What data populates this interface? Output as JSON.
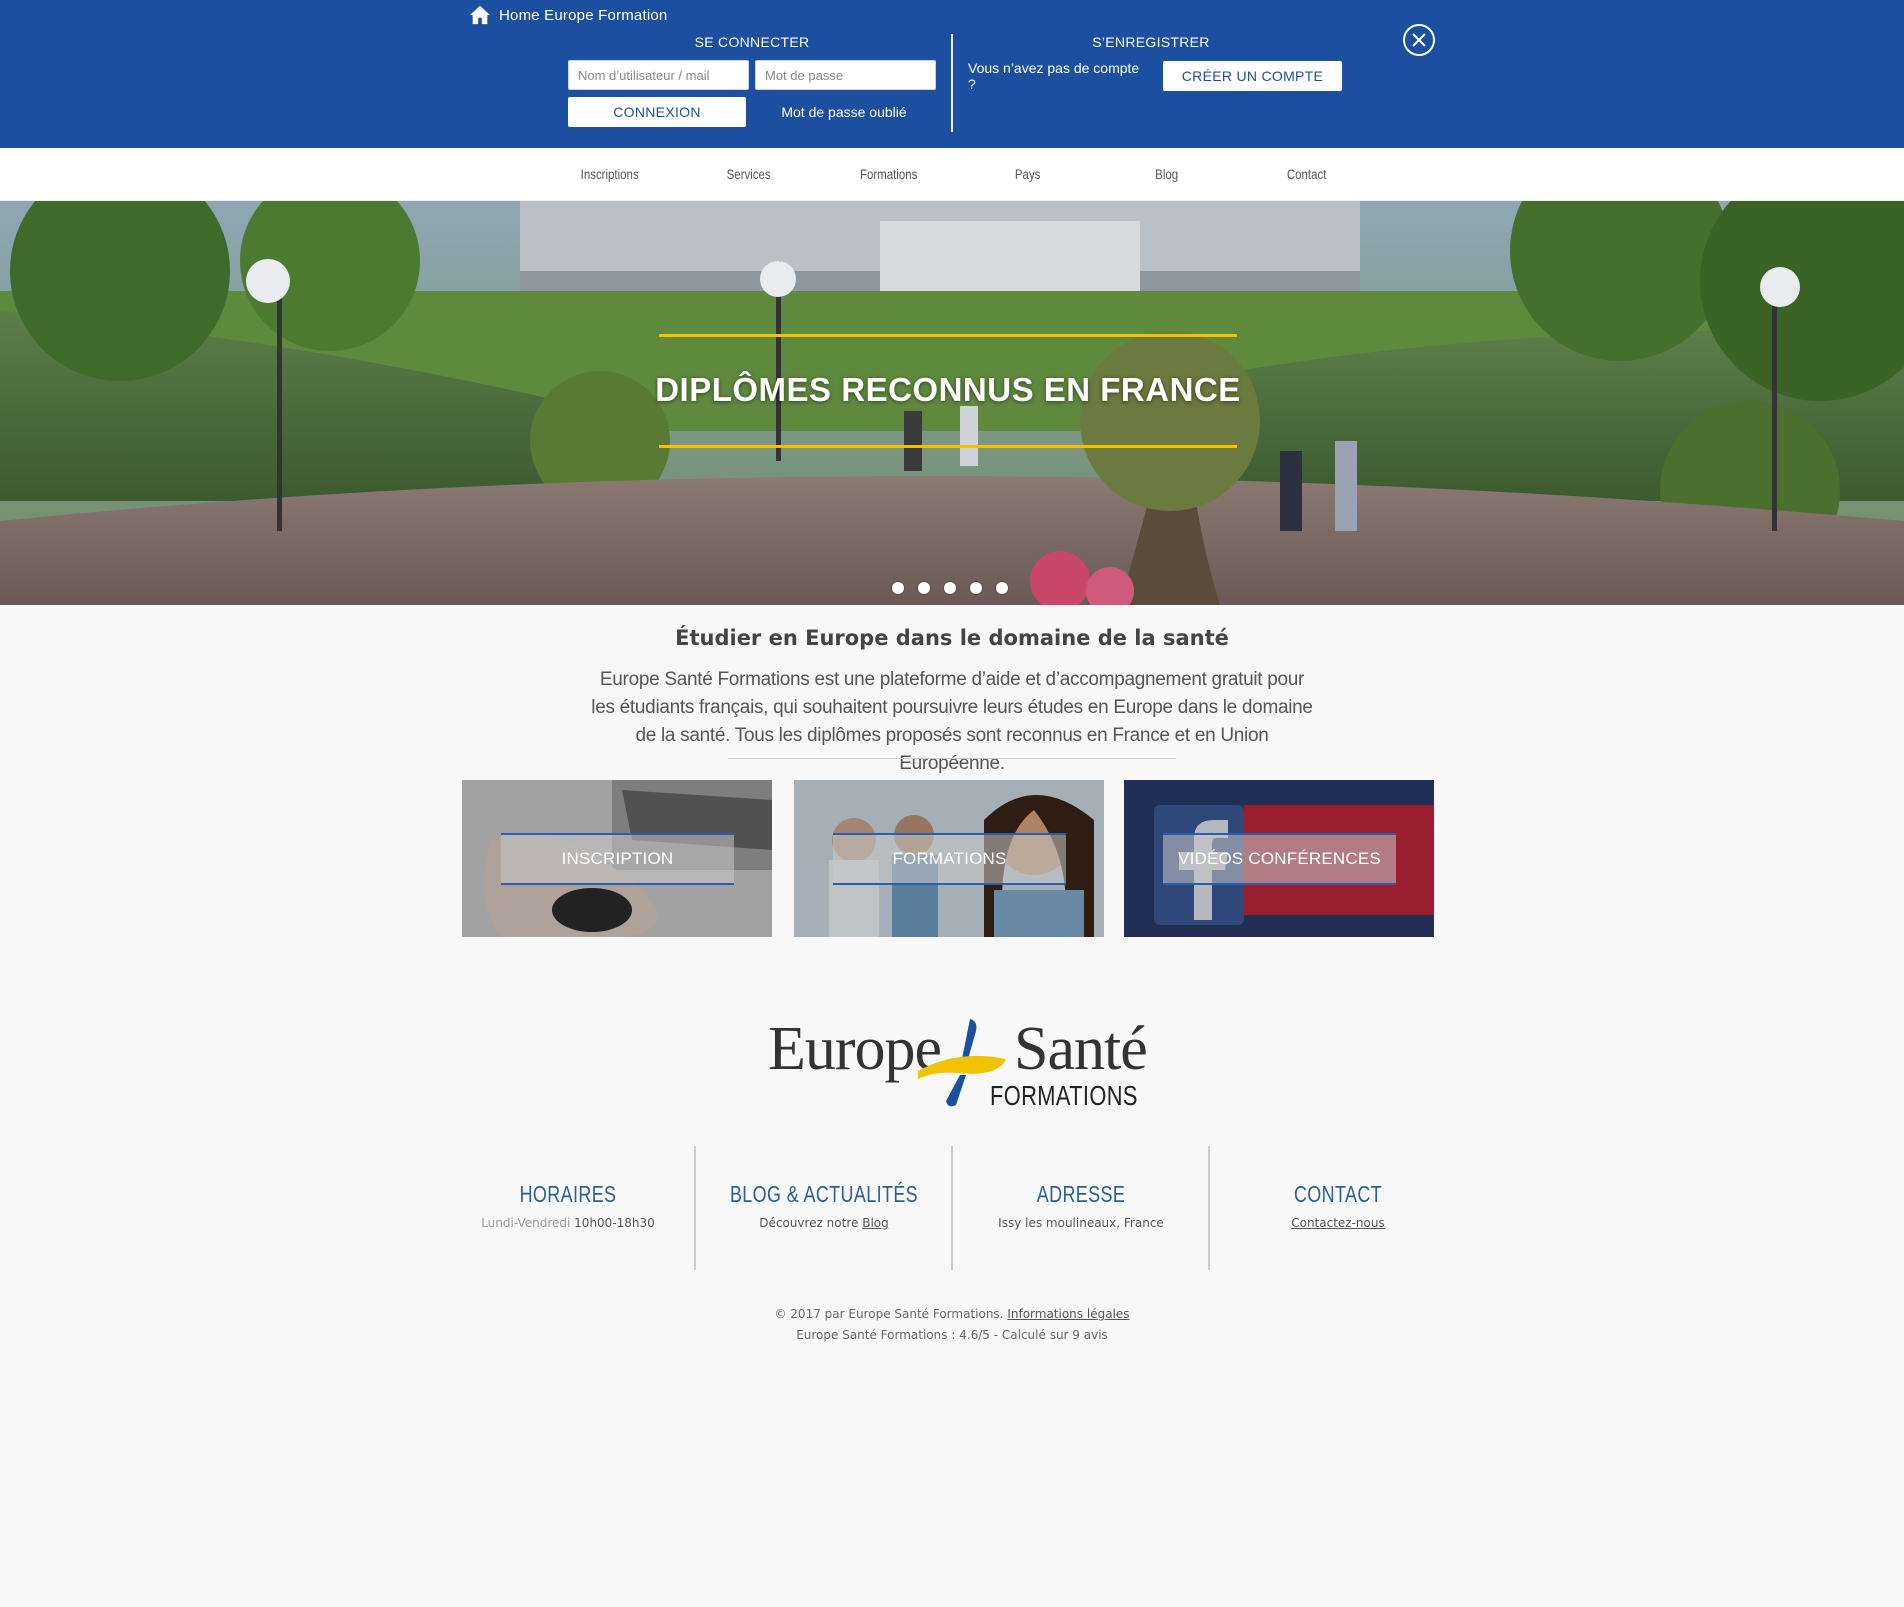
{
  "topbar": {
    "home_label": "Home Europe Formation",
    "login_title": "SE CONNECTER",
    "username_placeholder": "Nom d’utilisateur / mail",
    "password_placeholder": "Mot de passe",
    "login_button": "CONNEXION",
    "forgot_password": "Mot de passe oublié",
    "register_title": "S’ENREGISTRER",
    "no_account_question": "Vous n’avez pas de compte ?",
    "create_account_button": "CRÉER UN COMPTE"
  },
  "nav": {
    "items": [
      "Inscriptions",
      "Services",
      "Formations",
      "Pays",
      "Blog",
      "Contact"
    ]
  },
  "hero": {
    "title": "DIPLÔMES RECONNUS EN FRANCE",
    "slide_count": 5,
    "accent_color": "#f2c200"
  },
  "intro": {
    "title": "Étudier en Europe dans le domaine de la santé",
    "text": "Europe Santé Formations est une plateforme d’aide et d’accompagnement gratuit pour les étudiants français, qui souhaitent poursuivre leurs études en Europe dans le domaine de la santé. Tous les diplômes proposés sont reconnus en France et en Union Européenne."
  },
  "tiles": [
    {
      "label": "INSCRIPTION"
    },
    {
      "label": "FORMATIONS"
    },
    {
      "label": "VIDÉOS CONFÉRENCES"
    }
  ],
  "logo": {
    "word1": "Europe",
    "word2": "Santé",
    "word3": "FORMATIONS"
  },
  "footer": {
    "hours": {
      "title": "HORAIRES",
      "days": "Lundi-Vendredi",
      "time": "10h00-18h30"
    },
    "blog": {
      "title": "BLOG & ACTUALITÉS",
      "text": "Découvrez notre",
      "link": "Blog"
    },
    "address": {
      "title": "ADRESSE",
      "text": "Issy les moulineaux, France"
    },
    "contact": {
      "title": "CONTACT",
      "link": "Contactez-nous"
    },
    "copyright": "© 2017 par Europe Santé Formations.",
    "legal_link": "Informations légales",
    "rating": "Europe Santé Formations : 4.6/5 - Calculé sur 9 avis"
  },
  "colors": {
    "brand_blue": "#1c4fa0",
    "footer_title": "#2b5e94"
  }
}
